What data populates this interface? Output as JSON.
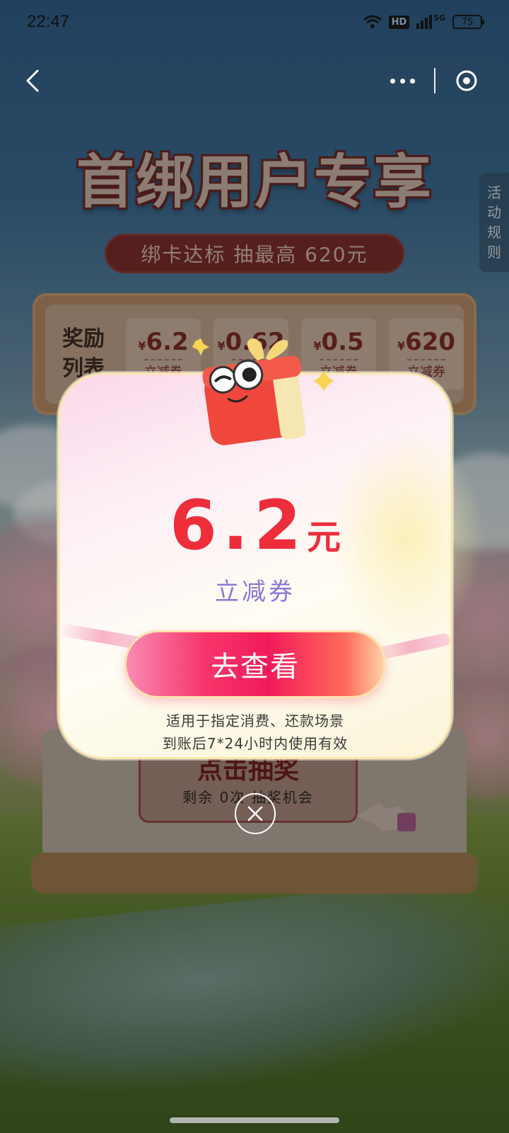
{
  "status_bar": {
    "time": "22:47",
    "network_badge": "HD",
    "signal_label": "5G",
    "battery": "75"
  },
  "nav": {
    "back_icon": "chevron-left-icon",
    "more_icon": "more-dots-icon",
    "close_icon": "close-circle-icon"
  },
  "page": {
    "headline": "首绑用户专享",
    "subtitle": "绑卡达标 抽最高 620元",
    "rules_tab": [
      "活",
      "动",
      "规",
      "则"
    ]
  },
  "reward_list": {
    "title_line1": "奖励",
    "title_line2": "列表",
    "coupons": [
      {
        "currency": "¥",
        "value": "6.2",
        "type": "立减券"
      },
      {
        "currency": "¥",
        "value": "0.62",
        "type": "立减券"
      },
      {
        "currency": "¥",
        "value": "0.5",
        "type": "立减券"
      },
      {
        "currency": "¥",
        "value": "620",
        "type": "立减券"
      }
    ]
  },
  "draw_machine": {
    "button_title": "点击抽奖",
    "remaining": "剩余 0次 抽奖机会"
  },
  "modal": {
    "amount_value": "6.2",
    "amount_unit": "元",
    "coupon_type": "立减券",
    "cta_label": "去查看",
    "note_line1": "适用于指定消费、还款场景",
    "note_line2": "到账后7*24小时内使用有效",
    "close_icon": "close-x-icon"
  },
  "colors": {
    "amount_red": "#ee2d3b",
    "coupon_type_purple": "#8c78d6",
    "cta_pink": "#f21a5a",
    "modal_border": "#fde7a8"
  }
}
